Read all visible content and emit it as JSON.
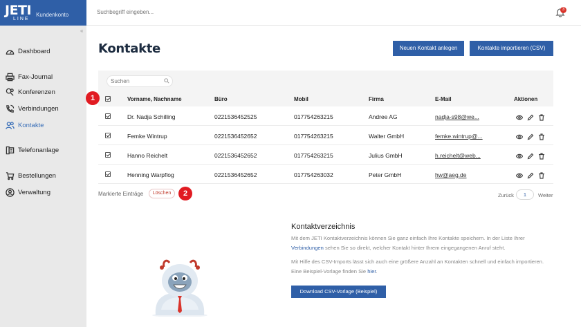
{
  "brand": {
    "logo_top": "JETI",
    "logo_bottom": "LINE",
    "subtitle": "Kundenkonto"
  },
  "topbar": {
    "search_placeholder": "Suchbegriff eingeben...",
    "notification_count": "3"
  },
  "sidebar": {
    "items": [
      {
        "label": "Dashboard",
        "icon": "dashboard-icon"
      },
      {
        "label": "Fax-Journal",
        "icon": "printer-icon"
      },
      {
        "label": "Konferenzen",
        "icon": "conference-icon"
      },
      {
        "label": "Verbindungen",
        "icon": "phone-icon"
      },
      {
        "label": "Kontakte",
        "icon": "contacts-icon",
        "active": true
      },
      {
        "label": "Telefonanlage",
        "icon": "phone-system-icon"
      },
      {
        "label": "Bestellungen",
        "icon": "cart-icon"
      },
      {
        "label": "Verwaltung",
        "icon": "user-circle-icon"
      }
    ]
  },
  "main": {
    "title": "Kontakte",
    "new_contact_label": "Neuen Kontakt anlegen",
    "import_label": "Kontakte importieren (CSV)",
    "search_placeholder": "Suchen",
    "columns": [
      "Vorname, Nachname",
      "Büro",
      "Mobil",
      "Firma",
      "E-Mail",
      "Aktionen"
    ],
    "rows": [
      {
        "name": "Dr. Nadja Schilling",
        "buero": "0221536452525",
        "mobil": "017754263215",
        "firma": "Andree AG",
        "email": "nadja-s98@we..."
      },
      {
        "name": "Femke Wintrup",
        "buero": "0221536452652",
        "mobil": "017754263215",
        "firma": "Walter GmbH",
        "email": "femke.wintrup@..."
      },
      {
        "name": "Hanno Reichelt",
        "buero": "0221536452652",
        "mobil": "017754263215",
        "firma": "Julius GmbH",
        "email": "h.reichelt@web..."
      },
      {
        "name": "Henning Warpflog",
        "buero": "0221536452652",
        "mobil": "017754263032",
        "firma": "Peter GmbH",
        "email": "hw@aeg.de"
      }
    ],
    "footer": {
      "marked_label": "Markierte Einträge",
      "delete_label": "Löschen",
      "prev_label": "Zurück",
      "page": "1",
      "next_label": "Weiter"
    },
    "markers": [
      "1",
      "2"
    ]
  },
  "info": {
    "title": "Kontaktverzeichnis",
    "p1_pre": "Mit dem JETI Kontaktverzeichnis können Sie ganz einfach Ihre Kontakte speichern. In der Liste Ihrer",
    "p1_link": "Verbindungen",
    "p1_post": " sehen Sie so direkt, welcher Kontakt hinter Ihrem eingegangenen Anruf steht.",
    "p2_line1": "Mit Hilfe des CSV-Imports lässt sich auch eine größere Anzahl an Kontakten schnell und einfach importieren.",
    "p2_line2_pre": "Eine Beispiel-Vorlage finden Sie ",
    "p2_link": "hier",
    "p2_line2_post": ".",
    "download_label": "Download CSV-Vorlage (Beispiel)"
  },
  "colors": {
    "brand_blue": "#2f5fa7",
    "marker_red": "#e11b22",
    "sidebar_bg": "#e9e9e9"
  }
}
